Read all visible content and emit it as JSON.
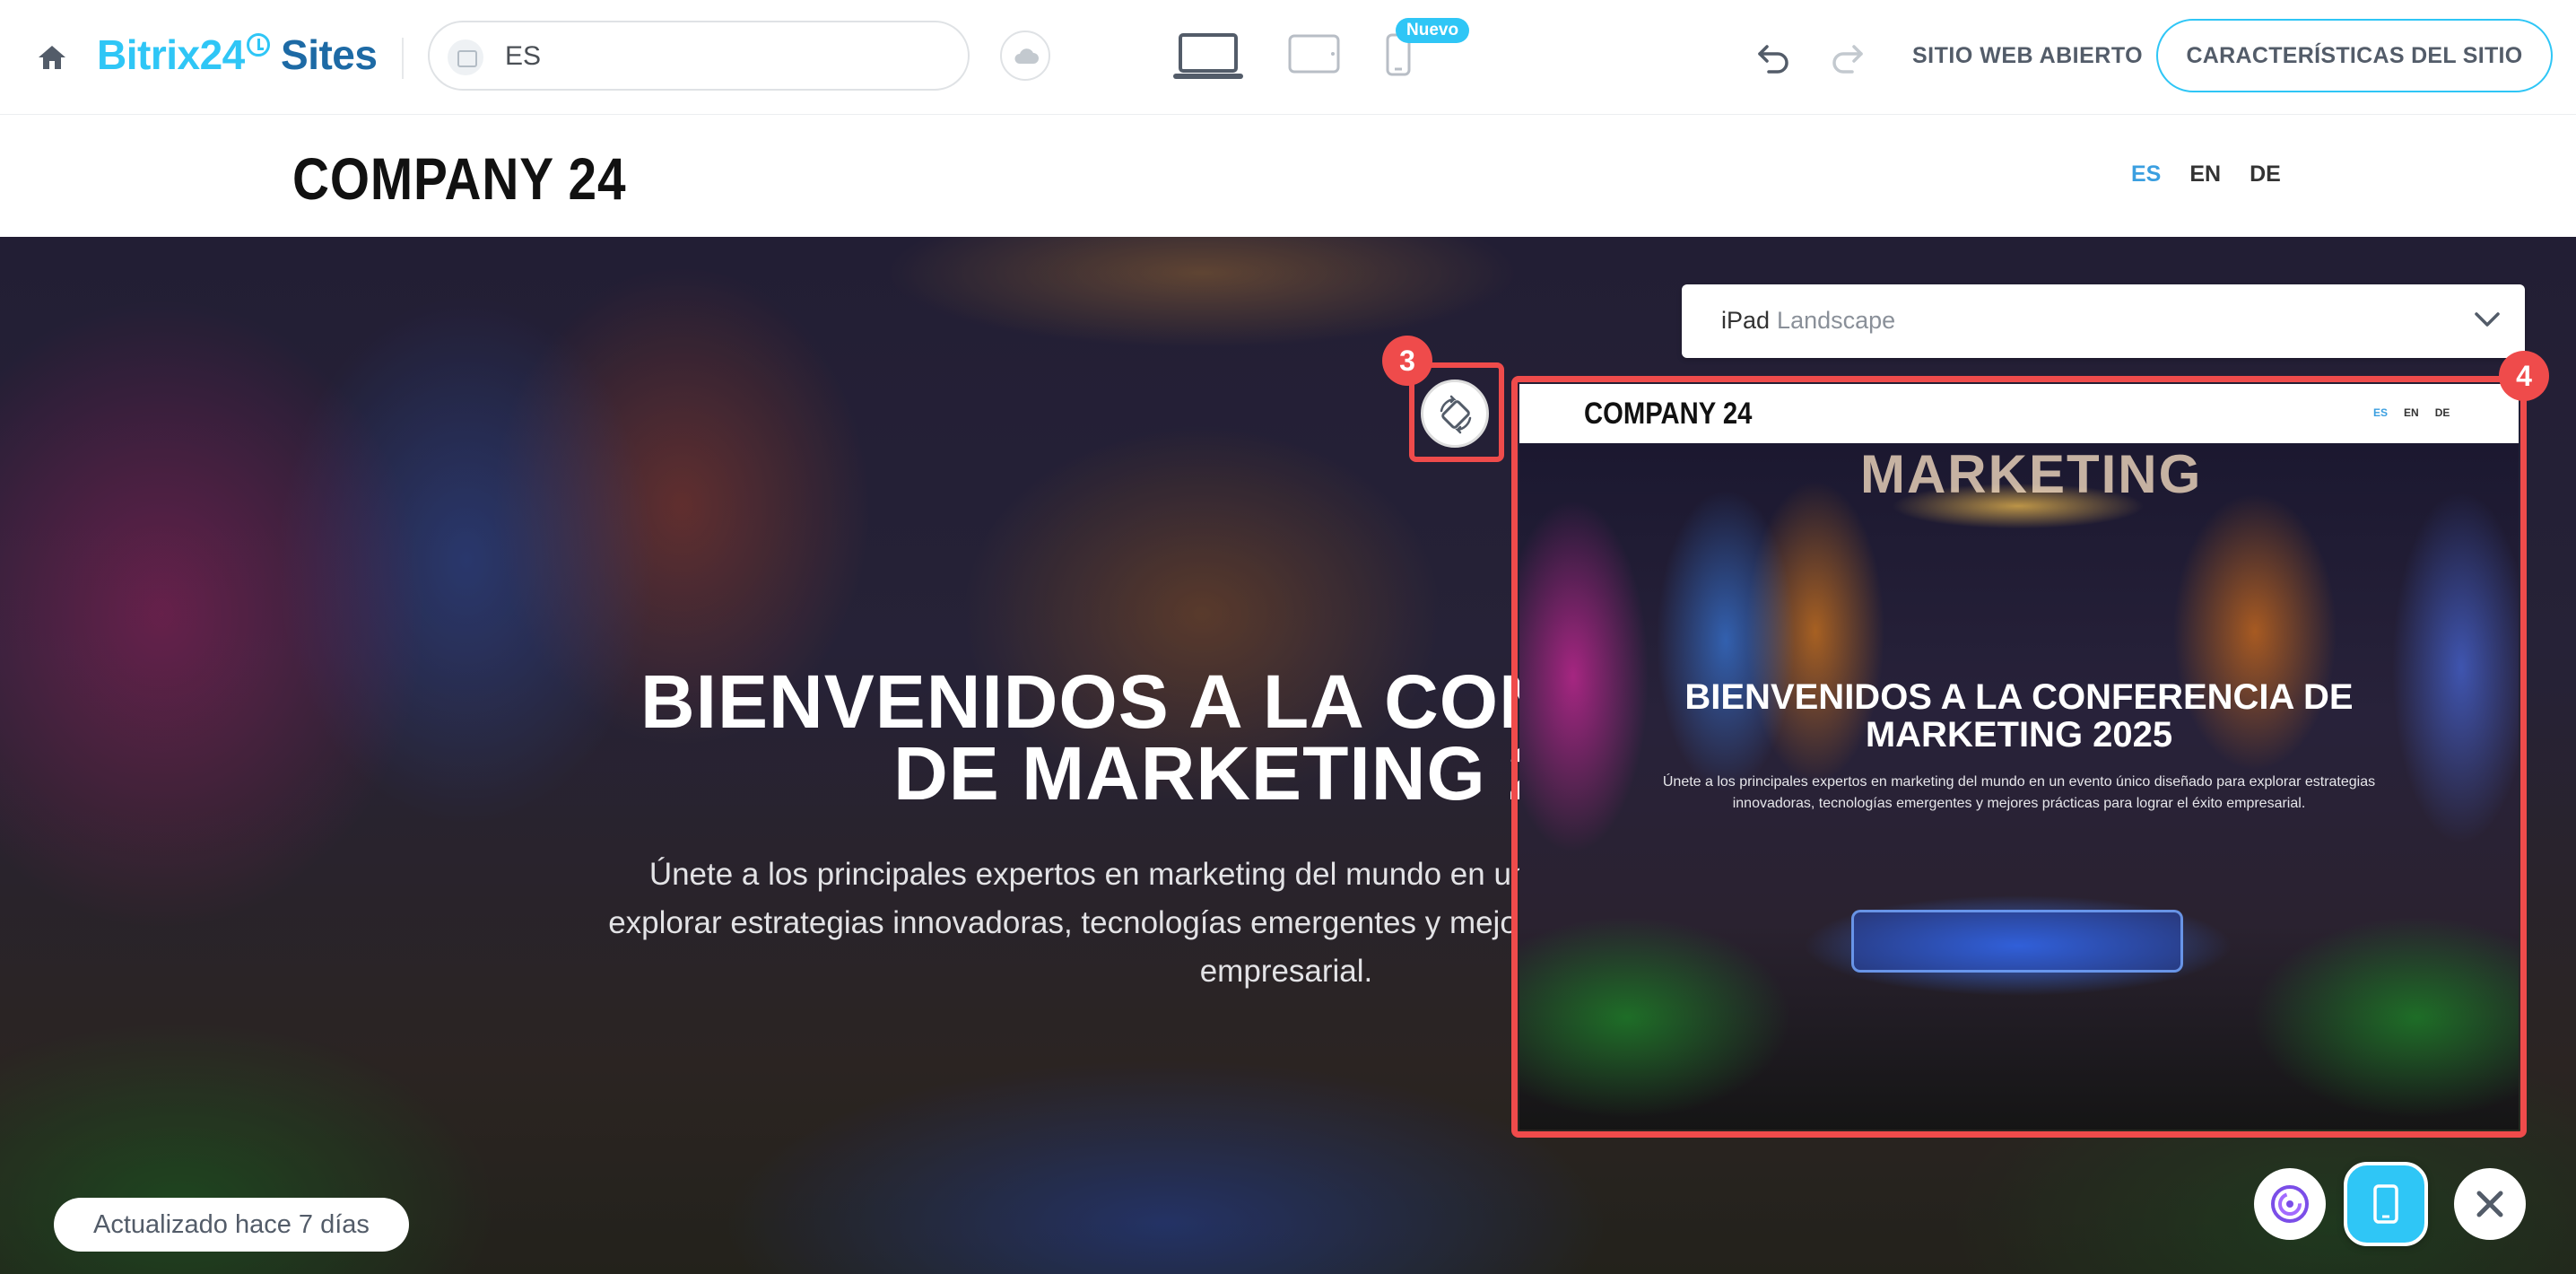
{
  "toolbar": {
    "logo_part1": "Bitrix24",
    "logo_part2": "Sites",
    "search_value": "ES",
    "badge_new": "Nuevo",
    "open_site_label": "SITIO WEB ABIERTO",
    "features_label": "CARACTERÍSTICAS DEL SITIO",
    "icons": [
      "home-icon",
      "image-icon",
      "cloud-icon",
      "laptop-icon",
      "tablet-icon",
      "phone-icon",
      "undo-icon",
      "redo-icon"
    ]
  },
  "site": {
    "company_name": "COMPANY 24",
    "languages": [
      "ES",
      "EN",
      "DE"
    ],
    "active_language": "ES"
  },
  "hero": {
    "title_line1": "BIENVENIDOS A LA CONFERENCIA",
    "title_line2": "DE MARKETING 2025",
    "subtitle": "Únete a los principales expertos en marketing del mundo en un evento único diseñado para explorar estrategias innovadoras, tecnologías emergentes y mejores prácticas para lograr el éxito empresarial."
  },
  "preview": {
    "device_name": "iPad",
    "orientation": "Landscape",
    "callout_rotate": "3",
    "callout_preview": "4",
    "company_name": "COMPANY 24",
    "languages": [
      "ES",
      "EN",
      "DE"
    ],
    "backdrop_text": "MARKETING",
    "title": "BIENVENIDOS A LA CONFERENCIA DE MARKETING 2025",
    "subtitle": "Únete a los principales expertos en marketing del mundo en un evento único diseñado para explorar estrategias innovadoras, tecnologías emergentes y mejores prácticas para lograr el éxito empresarial."
  },
  "footer": {
    "updated_label": "Actualizado hace 7 días"
  },
  "colors": {
    "accent": "#2fc6f6",
    "brand_dark": "#1d6aa5",
    "highlight": "#ef4b4b",
    "active_lang": "#3b9fe0"
  }
}
